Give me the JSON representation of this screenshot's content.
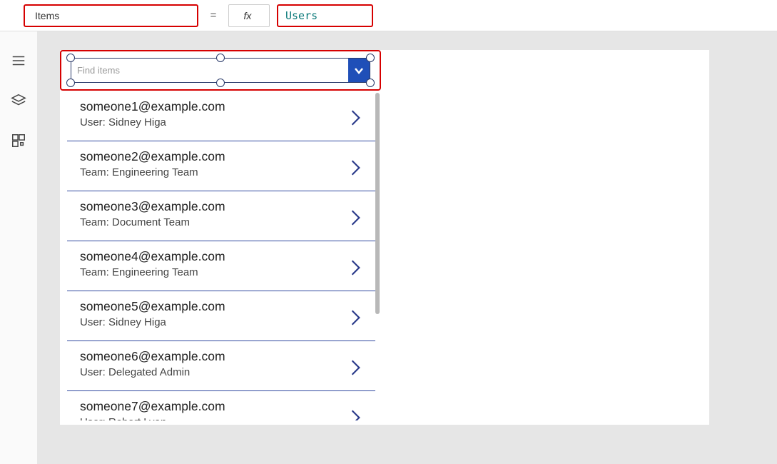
{
  "formula_bar": {
    "property_label": "Items",
    "equals": "=",
    "fx_label": "fx",
    "formula_value": "Users"
  },
  "combo": {
    "placeholder": "Find items"
  },
  "list_items": [
    {
      "title": "someone1@example.com",
      "subtitle": "User: Sidney Higa"
    },
    {
      "title": "someone2@example.com",
      "subtitle": "Team: Engineering Team"
    },
    {
      "title": "someone3@example.com",
      "subtitle": "Team: Document Team"
    },
    {
      "title": "someone4@example.com",
      "subtitle": "Team: Engineering Team"
    },
    {
      "title": "someone5@example.com",
      "subtitle": "User: Sidney Higa"
    },
    {
      "title": "someone6@example.com",
      "subtitle": "User: Delegated Admin"
    },
    {
      "title": "someone7@example.com",
      "subtitle": "User: Robert Lyon"
    }
  ]
}
